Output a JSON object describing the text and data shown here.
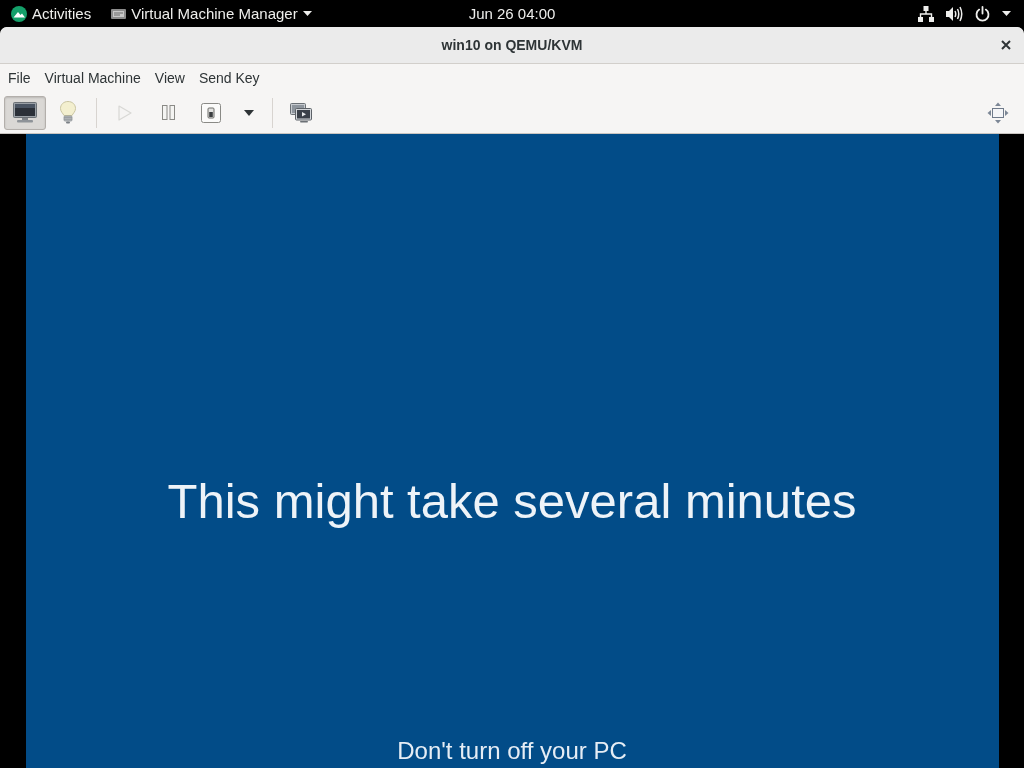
{
  "top_bar": {
    "activities": "Activities",
    "app_menu": "Virtual Machine Manager",
    "clock": "Jun 26 04:00"
  },
  "window": {
    "title": "win10 on QEMU/KVM"
  },
  "menu_bar": {
    "items": [
      "File",
      "Virtual Machine",
      "View",
      "Send Key"
    ]
  },
  "toolbar": {
    "groups": [
      [
        {
          "kind": "console",
          "selected": true,
          "disabled": false
        },
        {
          "kind": "details",
          "selected": false,
          "disabled": false
        }
      ],
      [
        {
          "kind": "run",
          "selected": false,
          "disabled": true
        },
        {
          "kind": "pause",
          "selected": false,
          "disabled": false
        },
        {
          "kind": "shutdown",
          "selected": false,
          "disabled": false
        },
        {
          "kind": "menu",
          "selected": false,
          "disabled": false
        }
      ],
      [
        {
          "kind": "snapshots",
          "selected": false,
          "disabled": false
        }
      ]
    ],
    "trailing": [
      {
        "kind": "fullscreen",
        "selected": false,
        "disabled": false
      }
    ]
  },
  "guest_screen": {
    "message": "This might take several minutes",
    "footer": "Don't turn off your PC"
  }
}
